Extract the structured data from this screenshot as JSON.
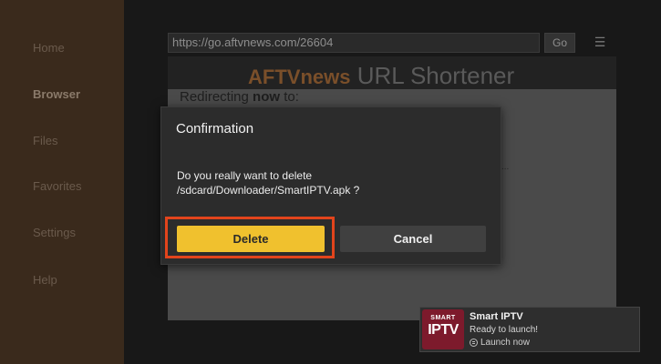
{
  "sidebar": {
    "items": [
      {
        "label": "Home"
      },
      {
        "label": "Browser"
      },
      {
        "label": "Files"
      },
      {
        "label": "Favorites"
      },
      {
        "label": "Settings"
      },
      {
        "label": "Help"
      }
    ]
  },
  "browser": {
    "url": "https://go.aftvnews.com/26604",
    "go_label": "Go",
    "menu_icon": "hamburger-menu-icon",
    "site_title_brand": "AFTVnews",
    "site_title_rest": " URL Shortener",
    "redirect_prefix": "Redirecting ",
    "redirect_bold": "now",
    "redirect_suffix": " to:",
    "ellipsis": "..."
  },
  "dialog": {
    "title": "Confirmation",
    "message": "Do you really want to delete /sdcard/Downloader/SmartIPTV.apk ?",
    "delete_label": "Delete",
    "cancel_label": "Cancel"
  },
  "toast": {
    "logo_top": "SMART",
    "logo_main": "IPTV",
    "title": "Smart IPTV",
    "subtitle": "Ready to launch!",
    "action_label": "Launch now",
    "action_icon": "menu-button-icon"
  },
  "colors": {
    "accent": "#f0c12e",
    "highlight": "#e2441c",
    "dialog_bg": "#2c2c2c",
    "logo_bg": "#7d1a2c"
  }
}
